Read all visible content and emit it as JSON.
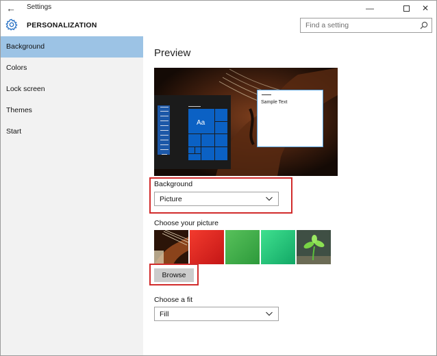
{
  "window": {
    "title": "Settings",
    "back_icon": "back-arrow-icon",
    "controls": [
      "minimize-icon",
      "maximize-icon",
      "close-icon"
    ]
  },
  "header": {
    "icon": "gear-icon",
    "title": "PERSONALIZATION",
    "search": {
      "placeholder": "Find a setting",
      "value": "",
      "icon": "search-icon"
    }
  },
  "sidebar": {
    "items": [
      {
        "label": "Background",
        "selected": true
      },
      {
        "label": "Colors",
        "selected": false
      },
      {
        "label": "Lock screen",
        "selected": false
      },
      {
        "label": "Themes",
        "selected": false
      },
      {
        "label": "Start",
        "selected": false
      }
    ]
  },
  "main": {
    "heading": "Preview",
    "preview": {
      "tile_text": "Aa",
      "window_text": "Sample Text"
    },
    "background_setting": {
      "label": "Background",
      "selected": "Picture"
    },
    "choose_picture": {
      "label": "Choose your picture",
      "thumbnails": [
        "violin-picture",
        "red-picture",
        "green-picture",
        "teal-picture",
        "plant-picture"
      ]
    },
    "browse_label": "Browse",
    "fit_setting": {
      "label": "Choose a fit",
      "selected": "Fill"
    }
  },
  "colors": {
    "accent": "#0b61c4",
    "selected_nav": "#9cc3e5",
    "sidebar_bg": "#f2f2f2",
    "annotation_red": "#d12a2a",
    "button_bg": "#cccccc"
  }
}
